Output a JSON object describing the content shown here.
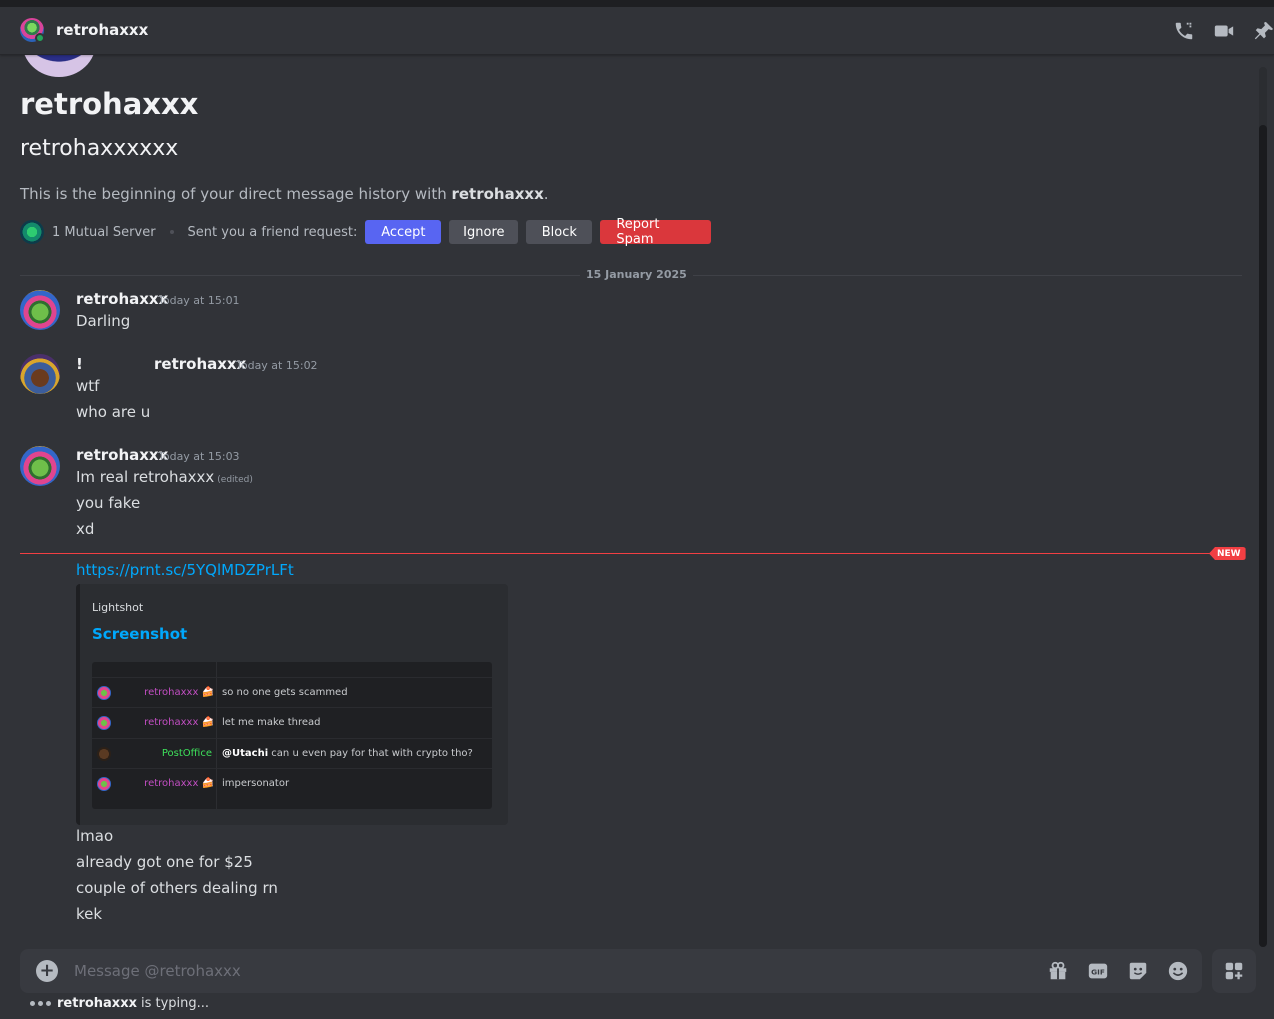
{
  "header": {
    "username": "retrohaxxx"
  },
  "intro": {
    "display_name": "retrohaxxx",
    "username": "retrohaxxxxxx",
    "beginning_prefix": "This is the beginning of your direct message history with ",
    "beginning_user": "retrohaxxx",
    "beginning_suffix": ".",
    "mutual_servers": "1 Mutual Server",
    "friend_request_text": "Sent you a friend request:",
    "accept_label": "Accept",
    "ignore_label": "Ignore",
    "block_label": "Block",
    "report_label": "Report Spam"
  },
  "date_divider": "15 January 2025",
  "messages": [
    {
      "author": "retrohaxxx",
      "timestamp": "Today at 15:01",
      "lines": [
        "Darling"
      ]
    },
    {
      "author_prefix": "!",
      "author": "retrohaxxx",
      "timestamp": "Today at 15:02",
      "lines": [
        "wtf",
        "who are u"
      ]
    },
    {
      "author": "retrohaxxx",
      "timestamp": "Today at 15:03",
      "lines": [
        "Im real retrohaxxx",
        "you fake",
        "xd"
      ],
      "edited": "(edited)"
    }
  ],
  "new_marker": "NEW",
  "link": "https://prnt.sc/5YQlMDZPrLFt",
  "embed": {
    "provider": "Lightshot",
    "title": "Screenshot",
    "rows": [
      {
        "name": "retrohaxxx 🍰",
        "text": "so no one gets scammed",
        "mention": ""
      },
      {
        "name": "retrohaxxx 🍰",
        "text": "let me make thread",
        "mention": ""
      },
      {
        "name": "PostOffice",
        "text": " can u even pay for that with crypto tho?",
        "mention": "@Utachi"
      },
      {
        "name": "retrohaxxx 🍰",
        "text": "impersonator",
        "mention": ""
      }
    ]
  },
  "after_lines": [
    "lmao",
    "already got one for $25",
    "couple of others dealing rn",
    "kek"
  ],
  "composer": {
    "placeholder": "Message @retrohaxxx"
  },
  "typing": {
    "user": "retrohaxxx",
    "text": "is typing..."
  },
  "icons": [
    "phone-icon",
    "video-icon",
    "pin-icon",
    "plus-icon",
    "gift-icon",
    "gif-icon",
    "sticker-icon",
    "emoji-icon",
    "apps-icon"
  ],
  "colors": {
    "accent": "#5865f2",
    "danger": "#da373c",
    "link": "#00a8fc",
    "online": "#23a55a",
    "new": "#f23f43"
  }
}
